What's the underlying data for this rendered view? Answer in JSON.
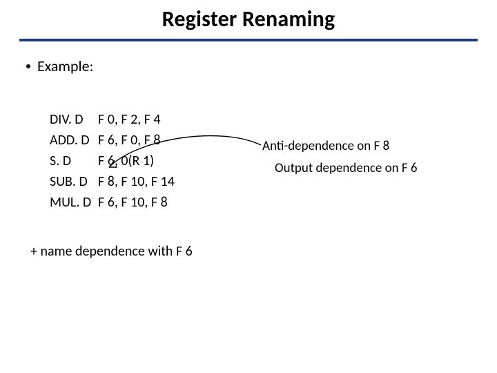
{
  "title": "Register Renaming",
  "bullet": "Example:",
  "code": {
    "r0": {
      "mn": "DIV. D",
      "ops": "F 0, F 2, F 4"
    },
    "r1": {
      "mn": "ADD. D",
      "ops": "F 6, F 0, F 8"
    },
    "r2": {
      "mn": "S. D",
      "ops": "F 6, 0(R 1)"
    },
    "r3": {
      "mn": "SUB. D",
      "ops": "F 8, F 10, F 14"
    },
    "r4": {
      "mn": "MUL. D",
      "ops": "F 6, F 10, F 8"
    }
  },
  "notes": {
    "anti": "Anti-dependence on F 8",
    "output": "Output dependence on F 6"
  },
  "plus": "+ name dependence with F 6"
}
